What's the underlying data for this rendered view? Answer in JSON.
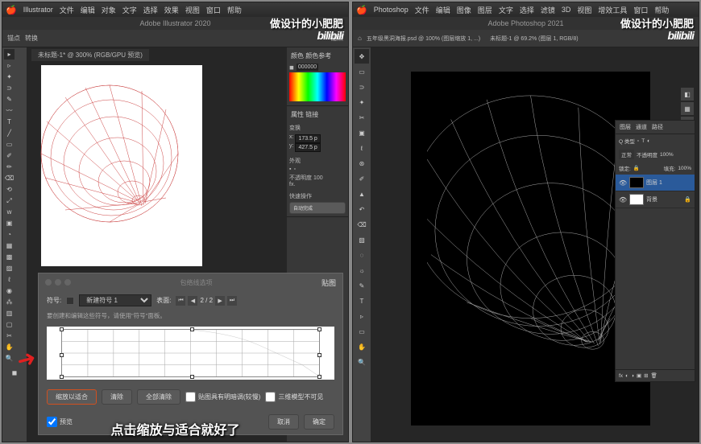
{
  "illustrator": {
    "appname": "Illustrator",
    "menus": [
      "文件",
      "编辑",
      "对象",
      "文字",
      "选择",
      "效果",
      "视图",
      "窗口",
      "帮助"
    ],
    "title": "Adobe Illustrator 2020",
    "opt_label1": "锚点",
    "opt_label2": "转换",
    "opt_label3": "锚点",
    "tab": "未标题-1* @ 300% (RGB/GPU 预览)",
    "color_panel": {
      "tabs": [
        "颜色",
        "颜色参考"
      ],
      "hex": "000000"
    },
    "props_panel": {
      "tabs": [
        "属性",
        "链接"
      ],
      "transform": "变换",
      "x": "173.5 p",
      "y": "427.5 p",
      "appearance": "外观",
      "opacity": "不透明度",
      "opacity_val": "100",
      "fx": "fx.",
      "quick": "快速操作",
      "auto": "自动完成"
    },
    "dialog": {
      "title_center": "包络线选项",
      "title": "贴图",
      "symbol_label": "符号:",
      "symbol_value": "新建符号 1",
      "surface_label": "表面:",
      "page": "2 / 2",
      "hint": "要创建和编辑这些符号，请使用\"符号\"面板。",
      "scale_fit": "缩放以适合",
      "clear": "清除",
      "clear_all": "全部清除",
      "shade": "贴图具有明暗调(较慢)",
      "invisible": "三维模型不可见",
      "preview": "预览",
      "cancel": "取消",
      "ok": "确定"
    }
  },
  "photoshop": {
    "appname": "Photoshop",
    "menus": [
      "文件",
      "编辑",
      "图像",
      "图层",
      "文字",
      "选择",
      "滤镜",
      "3D",
      "视图",
      "增效工具",
      "窗口",
      "帮助"
    ],
    "title": "Adobe Photoshop 2021",
    "tab": "五年级黑洞海报.psd @ 100% (图层缩放 1, ...)",
    "tab2": "未标题-1 @ 69.2% (图层 1, RGB/8)",
    "layers": {
      "tabs": [
        "图层",
        "通道",
        "路径"
      ],
      "kind": "Q 类型",
      "mode": "正常",
      "opacity_label": "不透明度",
      "opacity": "100%",
      "lock": "锁定:",
      "fill_label": "填充:",
      "fill": "100%",
      "layer1": "图层 1",
      "bg": "背景"
    }
  },
  "watermark": "做设计的小肥肥",
  "bilibili": "bilibili",
  "subtitle": "点击缩放与适合就好了"
}
